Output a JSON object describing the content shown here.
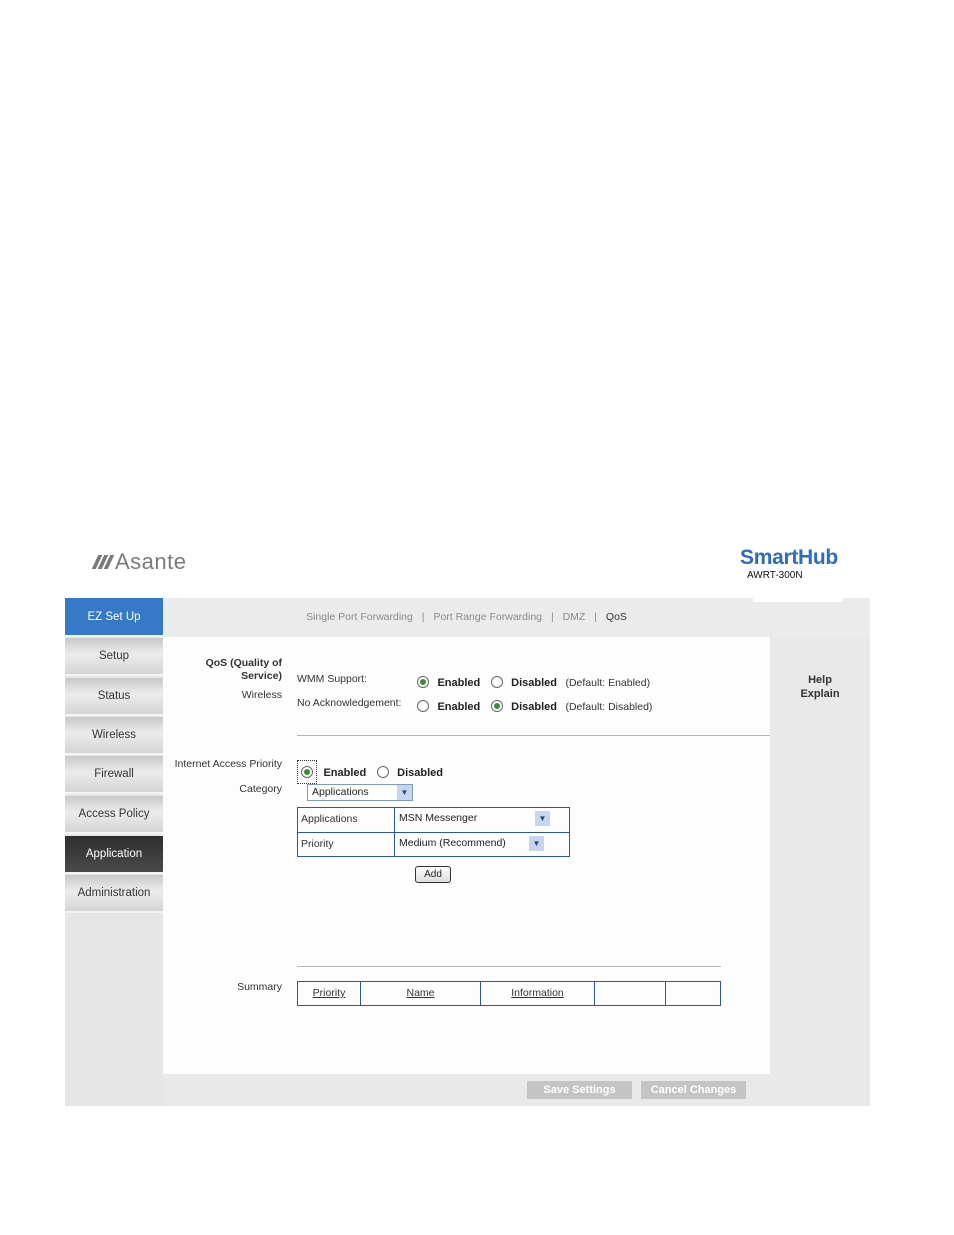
{
  "header": {
    "logo_text": "Asante",
    "brand_title": "SmartHub",
    "brand_model": "AWRT-300N"
  },
  "sidebar": {
    "items": [
      {
        "label": "EZ Set Up"
      },
      {
        "label": "Setup"
      },
      {
        "label": "Status"
      },
      {
        "label": "Wireless"
      },
      {
        "label": "Firewall"
      },
      {
        "label": "Access Policy"
      },
      {
        "label": "Application"
      },
      {
        "label": "Administration"
      }
    ],
    "active": "Application"
  },
  "subtabs": {
    "items": [
      "Single Port Forwarding",
      "Port Range Forwarding",
      "DMZ",
      "QoS"
    ],
    "separator": "|",
    "current": "QoS"
  },
  "qos": {
    "section_title_line1": "QoS (Quality of",
    "section_title_line2": "Service)",
    "wireless_label": "Wireless",
    "wmm_label": "WMM Support:",
    "wmm_enabled": "Enabled",
    "wmm_disabled": "Disabled",
    "wmm_default": "(Default: Enabled)",
    "wmm_value": "Enabled",
    "noack_label": "No Acknowledgement:",
    "noack_enabled": "Enabled",
    "noack_disabled": "Disabled",
    "noack_default": "(Default: Disabled)",
    "noack_value": "Disabled"
  },
  "internet_priority": {
    "label": "Internet Access Priority",
    "enabled": "Enabled",
    "disabled": "Disabled",
    "value": "Enabled",
    "category_label": "Category",
    "category_value": "Applications",
    "applications_label": "Applications",
    "applications_value": "MSN Messenger",
    "priority_label": "Priority",
    "priority_value": "Medium (Recommend)",
    "add_button": "Add"
  },
  "summary": {
    "label": "Summary",
    "columns": [
      "Priority",
      "Name",
      "Information",
      "",
      ""
    ]
  },
  "help": {
    "line1": "Help",
    "line2": "Explain"
  },
  "footer": {
    "save_button": "Save Settings",
    "cancel_button": "Cancel Changes"
  },
  "colors": {
    "ez_setup_bg": "#3679c7",
    "active_menu_bg": "#3a3a3a",
    "brand_blue": "#2e6cc0",
    "table_border": "#2c57a6",
    "radio_selected": "#3a8a3a"
  }
}
